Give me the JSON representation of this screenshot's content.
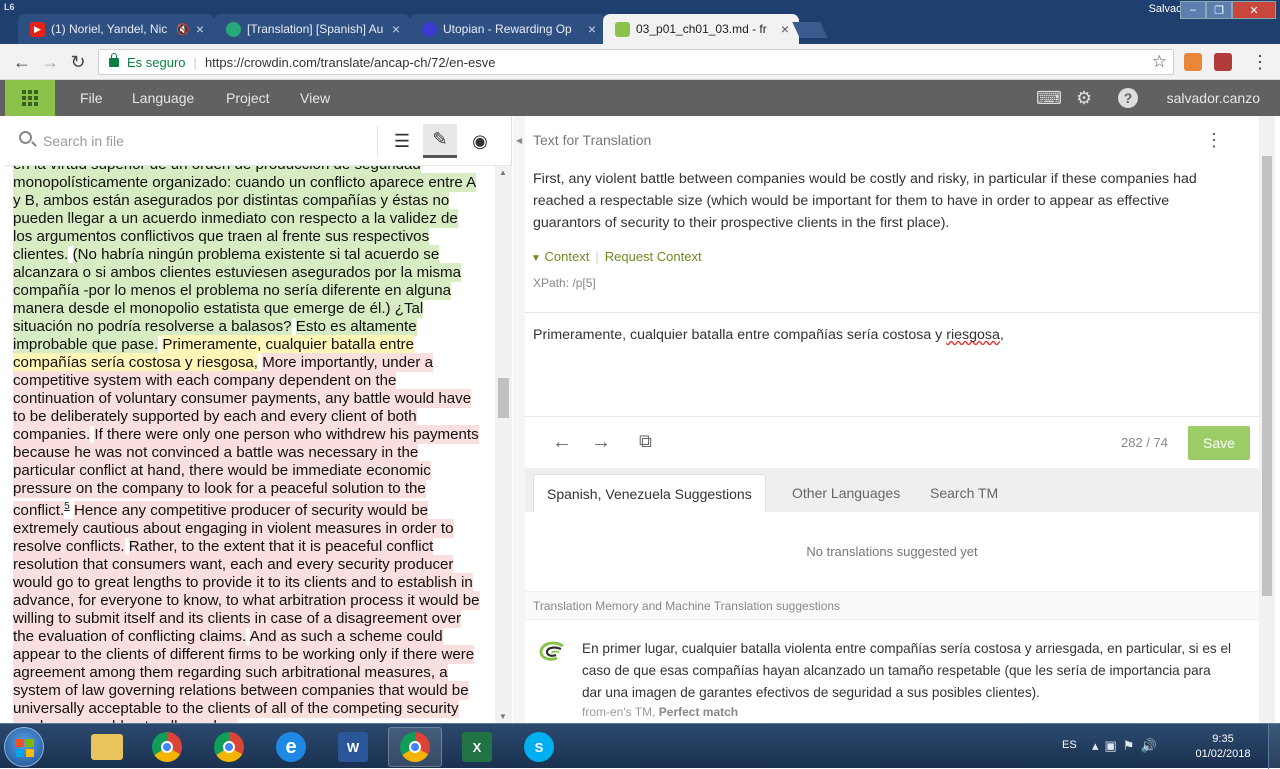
{
  "os": {
    "window_user": "Salvador",
    "taskbar": {
      "language": "ES",
      "time": "9:35",
      "date": "01/02/2018",
      "apps": [
        "windows-explorer",
        "chrome",
        "chrome",
        "internet-explorer",
        "word",
        "chrome",
        "excel",
        "skype"
      ]
    }
  },
  "browser": {
    "tabs": [
      {
        "title": "(1) Noriel, Yandel, Nic",
        "icon": "youtube-icon"
      },
      {
        "title": "[Translation] [Spanish] Au",
        "icon": "crowdin-icon"
      },
      {
        "title": "Utopian - Rewarding Op",
        "icon": "utopian-icon"
      },
      {
        "title": "03_p01_ch01_03.md - fr",
        "icon": "crowdin-icon",
        "active": true
      }
    ],
    "secure_label": "Es seguro",
    "url": "https://crowdin.com/translate/ancap-ch/72/en-esve"
  },
  "menubar": {
    "items": [
      "File",
      "Language",
      "Project",
      "View"
    ],
    "username": "salvador.canzo"
  },
  "left": {
    "search_placeholder": "Search in file",
    "segments": [
      {
        "state": "done",
        "text": "en la virtud superior de un orden de producción de seguridad monopolísticamente organizado: cuando un conflicto aparece entre A y B, ambos están asegurados por distintas compañías y éstas no pueden llegar a un acuerdo inmediato con respecto a la validez de los argumentos conflictivos que traen al frente sus respectivos clientes."
      },
      {
        "state": "done",
        "text": "(No habría ningún problema existente si tal acuerdo se alcanzara o si ambos clientes estuviesen asegurados por la misma compañía -por lo menos el problema no sería diferente en alguna manera desde el monopolio estatista que emerge de él.) ¿Tal situación no podría resolverse a balasos?"
      },
      {
        "state": "done",
        "text": "Esto es altamente improbable que pase."
      },
      {
        "state": "current",
        "text": "Primeramente, cualquier batalla entre compañías sería costosa y riesgosa,"
      },
      {
        "state": "untrans",
        "text": "More importantly, under a competitive system with each company dependent on the continuation of voluntary consumer payments, any battle would have to be deliberately supported by each and every client of both companies."
      },
      {
        "state": "untrans",
        "text": "If there were only one person who withdrew his payments because he was not convinced a battle was necessary in the particular conflict at hand, there would be immediate economic pressure on the company to look for a peaceful solution to the conflict."
      },
      {
        "state": "footnote",
        "text": "5"
      },
      {
        "state": "untrans",
        "text": "Hence any competitive producer of security would be extremely cautious about engaging in violent measures in order to resolve conflicts."
      },
      {
        "state": "untrans",
        "text": "Rather, to the extent that it is peaceful conflict resolution that consumers want, each and every security producer would go to great lengths to provide it to its clients and to establish in advance, for everyone to know, to what arbitration process it would be willing to submit itself and its clients in case of a disagreement over the evaluation of conflicting claims."
      },
      {
        "state": "untrans",
        "text": "And as such a scheme could appear to the clients of different firms to be working only if there were agreement among them regarding such arbitrational measures, a system of law governing relations between companies that would be universally acceptable to the clients of all of the competing security producers would naturally evolve."
      }
    ]
  },
  "right": {
    "source_label": "Text for Translation",
    "source_text": "First, any violent battle between companies would be costly and risky, in particular if these companies had reached a respectable size (which would be important for them to have in order to appear as effective guarantors of security to their prospective clients in the first place).",
    "context_link": "Context",
    "request_context": "Request Context",
    "xpath": "XPath: /p[5]",
    "translation_text": "Primeramente, cualquier batalla entre compañías sería costosa y ",
    "translation_misspelled": "riesgosa",
    "translation_tail": ",",
    "counter": "282 / 74",
    "save_label": "Save",
    "tabs": [
      "Spanish, Venezuela Suggestions",
      "Other Languages",
      "Search TM"
    ],
    "no_suggestions": "No translations suggested yet",
    "tm_header": "Translation Memory and Machine Translation suggestions",
    "tm_text": "En primer lugar, cualquier batalla violenta entre compañías sería costosa y arriesgada, en particular, si es el caso de que esas compañías hayan alcanzado un tamaño respetable (que les sería de importancia para dar una imagen de garantes efectivos de seguridad a sus posibles clientes).",
    "tm_source": "from-en's TM,",
    "tm_match": "Perfect match"
  }
}
